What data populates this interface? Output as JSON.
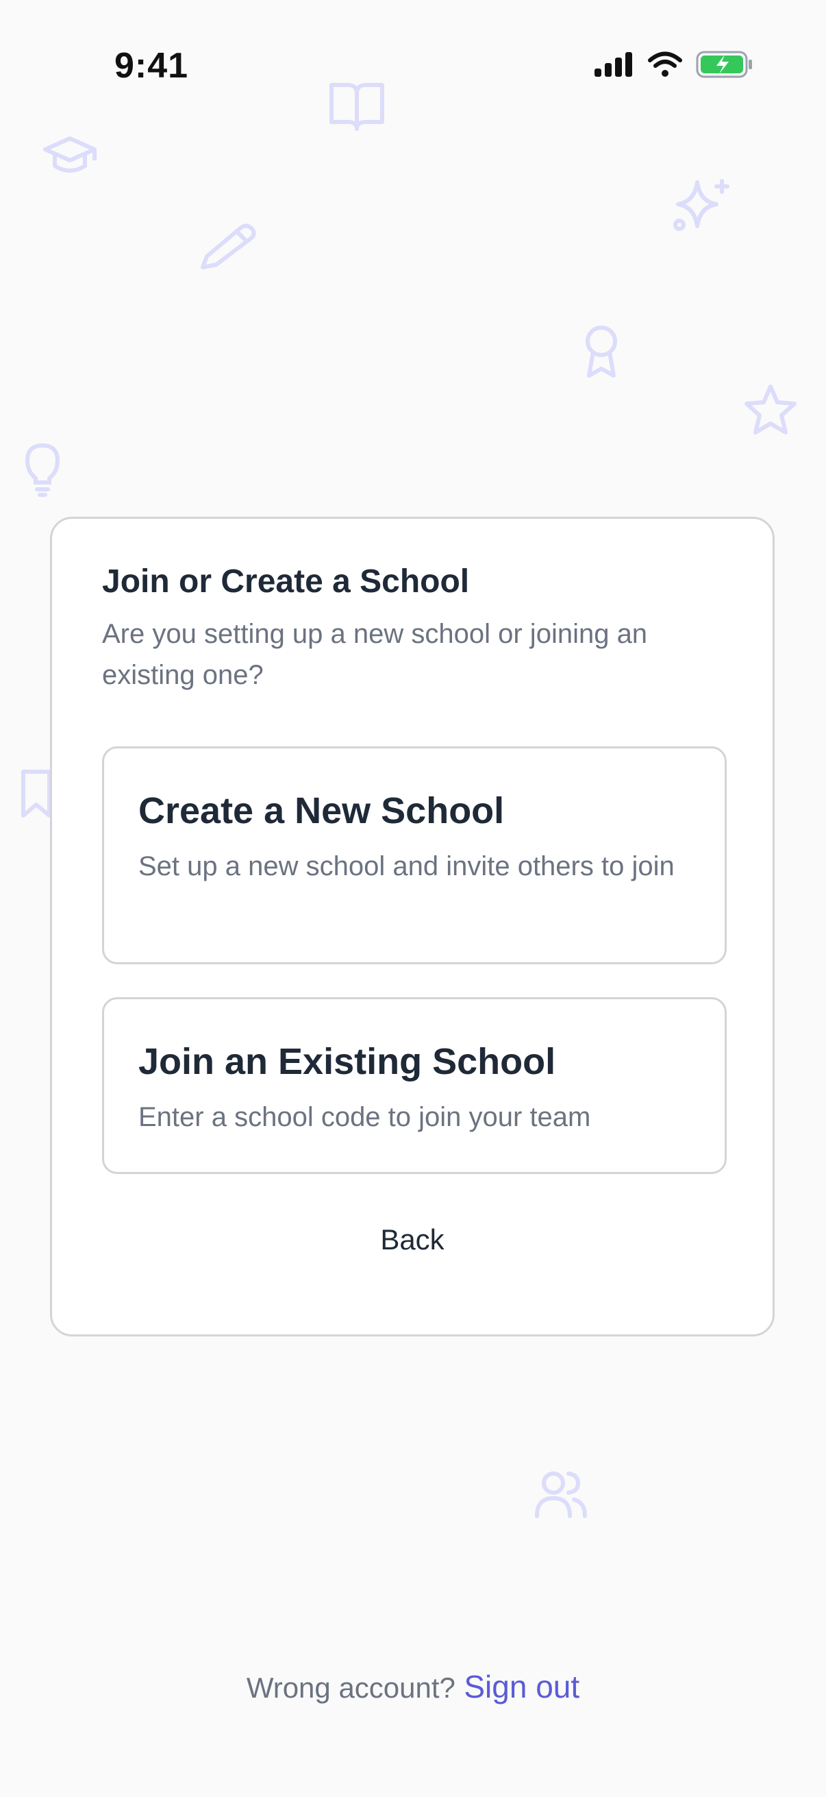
{
  "status_bar": {
    "time": "9:41",
    "icons": [
      "signal-icon",
      "wifi-icon",
      "battery-charging-icon"
    ],
    "battery_color": "#34c759"
  },
  "decorations": [
    "book-icon",
    "graduation-cap-icon",
    "sparkles-icon",
    "pencil-icon",
    "award-icon",
    "star-icon",
    "lightbulb-icon",
    "bookmark-icon",
    "users-icon"
  ],
  "colors": {
    "accent": "#5b5bd6",
    "decoration": "#dcdcfb",
    "title": "#1f2937",
    "muted": "#6b7280",
    "border": "#d4d4d8"
  },
  "card": {
    "title": "Join or Create a School",
    "subtitle": "Are you setting up a new school or joining an existing one?",
    "options": [
      {
        "title": "Create a New School",
        "description": "Set up a new school and invite others to join"
      },
      {
        "title": "Join an Existing School",
        "description": "Enter a school code to join your team"
      }
    ],
    "back_label": "Back"
  },
  "footer": {
    "prompt": "Wrong account?",
    "signout_label": "Sign out"
  }
}
